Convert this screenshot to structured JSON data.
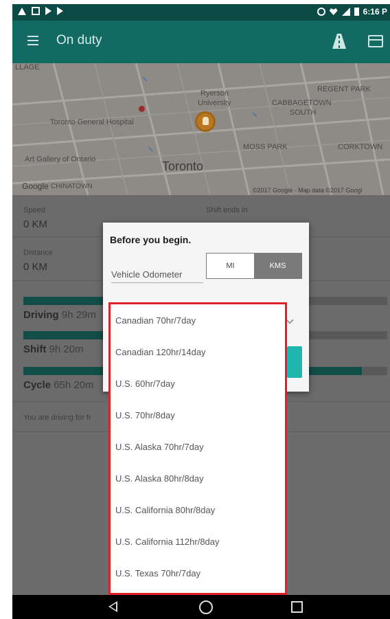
{
  "status_bar": {
    "time": "6:16 P"
  },
  "app_bar": {
    "title": "On duty",
    "menu_icon": "hamburger-icon",
    "road_icon": "road-icon",
    "card_icon": "card-icon"
  },
  "map": {
    "labels": {
      "ryerson": "Ryerson",
      "university": "University",
      "regent_park": "REGENT PARK",
      "cabbagetown": "CABBAGETOWN",
      "south": "SOUTH",
      "hospital": "Toronto General Hospital",
      "moss_park": "MOSS PARK",
      "corktown": "CORKTOWN",
      "art_gallery": "Art Gallery of Ontario",
      "toronto": "Toronto",
      "chinatown": "CHINATOWN",
      "google": "Google",
      "lage": "LLAGE",
      "footer": "©2017 Google · Map data ©2017 Googl"
    }
  },
  "info": {
    "speed_label": "Speed",
    "speed_value": "0 KM",
    "shift_ends_label": "Shift ends in",
    "distance_label": "Distance",
    "distance_value": "0  KM",
    "driving_label": "Driving",
    "driving_value": "9h 29m",
    "shift_label": "Shift",
    "shift_value": "9h 20m",
    "cycle_label": "Cycle",
    "cycle_value": "65h 20m",
    "driving_fraction": 0.22,
    "shift_fraction": 0.22,
    "cycle_fraction": 0.93,
    "footer_text": "You are driving  for fr"
  },
  "dialog": {
    "title": "Before you begin.",
    "odometer_placeholder": "Vehicle Odometer",
    "unit_mi": "MI",
    "unit_kms": "KMS",
    "selected_unit": "KMS"
  },
  "dropdown": {
    "options": [
      "Canadian 70hr/7day",
      "Canadian 120hr/14day",
      "U.S. 60hr/7day",
      "U.S. 70hr/8day",
      "U.S. Alaska 70hr/7day",
      "U.S. Alaska 80hr/8day",
      "U.S. California 80hr/8day",
      "U.S. California 112hr/8day",
      "U.S. Texas 70hr/7day"
    ],
    "highlight_color": "#e0212b"
  },
  "colors": {
    "primary": "#126a62",
    "status_bar": "#0b4a45",
    "accent": "#1fb6ae"
  }
}
